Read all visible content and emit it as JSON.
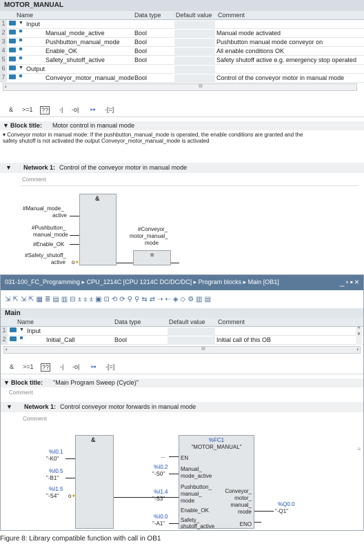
{
  "top": {
    "title": "MOTOR_MANUAL",
    "columns": [
      "Name",
      "Data type",
      "Default value",
      "Comment"
    ],
    "rows": [
      {
        "num": "1",
        "kind": "section",
        "name": "Input",
        "type": "",
        "comment": ""
      },
      {
        "num": "2",
        "kind": "var",
        "name": "Manual_mode_active",
        "type": "Bool",
        "comment": "Manual mode activated"
      },
      {
        "num": "3",
        "kind": "var",
        "name": "Pushbutton_manual_mode",
        "type": "Bool",
        "comment": "Pushbutton manual mode conveyor on"
      },
      {
        "num": "4",
        "kind": "var",
        "name": "Enable_OK",
        "type": "Bool",
        "comment": "All enable conditions OK"
      },
      {
        "num": "5",
        "kind": "var",
        "name": "Safety_shutoff_active",
        "type": "Bool",
        "comment": "Safety shutoff active e.g. emergency stop operated"
      },
      {
        "num": "6",
        "kind": "section",
        "name": "Output",
        "type": "",
        "comment": ""
      },
      {
        "num": "7",
        "kind": "var",
        "name": "Conveyor_motor_manual_mode",
        "type": "Bool",
        "comment": "Control of the conveyor motor in manual mode"
      }
    ],
    "toolbar": [
      "&",
      ">=1",
      "??",
      "-|",
      "-o|",
      "↦",
      "-[=]"
    ],
    "block_title_label": "Block title:",
    "block_title": "Motor control in manual mode",
    "block_comment": "Conveyor motor in manual mode: If the pushbutton_manual_mode is operated, the enable conditions are granted and the safety shutoff is not activated the output Conveyor_motor_manual_mode is activated",
    "network_label": "Network 1:",
    "network_title": "Control of the conveyor motor in manual mode",
    "comment_placeholder": "Comment",
    "fbd": {
      "and": "&",
      "in1": "#Manual_mode_",
      "in1b": "active",
      "in2": "#Pushbutton_",
      "in2b": "manual_mode",
      "in3": "#Enable_OK",
      "in4": "#Safety_shutoff_",
      "in4b": "active",
      "out1": "#Conveyor_",
      "out2": "motor_manual_",
      "out3": "mode",
      "assign": "="
    }
  },
  "bottom": {
    "window_title": "031-100_FC_Programming ▸ CPU_1214C [CPU 1214C DC/DC/DC] ▸ Program blocks ▸ Main [OB1]",
    "block_name": "Main",
    "columns": [
      "Name",
      "Data type",
      "Default value",
      "Comment"
    ],
    "rows": [
      {
        "num": "1",
        "kind": "section",
        "name": "Input",
        "type": "",
        "comment": ""
      },
      {
        "num": "2",
        "kind": "var",
        "name": "Initial_Call",
        "type": "Bool",
        "comment": "Initial call of this OB"
      }
    ],
    "scroll_mark": "III",
    "toolbar": [
      "&",
      ">=1",
      "??",
      "-|",
      "-o|",
      "↦",
      "-[=]"
    ],
    "block_title_label": "Block title:",
    "block_title": "\"Main Program Sweep (Cycle)\"",
    "comment_placeholder": "Comment",
    "network_label": "Network 1:",
    "network_title": "Control conveyor motor forwards in manual mode",
    "fbd": {
      "and": "&",
      "i1a": "%I0.1",
      "i1b": "\"-K0\"",
      "i2a": "%I0.5",
      "i2b": "\"-B1\"",
      "i3a": "%I1.5",
      "i3b": "\"-S4\"",
      "fc": "%FC1",
      "fcname": "\"MOTOR_MANUAL\"",
      "en": "EN",
      "dots": "...",
      "p1a": "%I0.2",
      "p1b": "\"-S0\"",
      "p1": "Manual_",
      "p1c": "mode_active",
      "p2a": "%I1.4",
      "p2b": "\"-S3\"",
      "p2": "Pushbutton_",
      "p2c": "manual_",
      "p2d": "mode",
      "p3": "Enable_OK",
      "p4a": "%I0.0",
      "p4b": "\"-A1\"",
      "p4": "Safety_",
      "p4c": "shutoff_active",
      "o1": "Conveyor_",
      "o2": "motor_",
      "o3": "manual_",
      "o4": "mode",
      "qa": "%Q0.0",
      "qb": "\"-Q1\"",
      "eno": "ENO"
    }
  },
  "caption": "Figure 8: Library compatible function with call in OB1",
  "colors": {
    "accent": "#2e7fb0",
    "window_bar": "#5b7a99",
    "address": "#1d4fb8"
  }
}
